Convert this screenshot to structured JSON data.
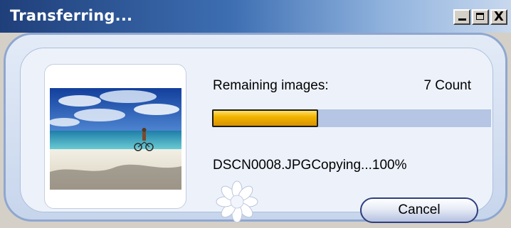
{
  "window": {
    "title": "Transferring...",
    "controls": {
      "minimize": "minimize",
      "maximize": "maximize",
      "close": "X"
    }
  },
  "transfer": {
    "remaining_label": "Remaining images:",
    "count_text": "7 Count",
    "progress_fraction": 0.38,
    "status_text": "DSCN0008.JPGCopying...100%"
  },
  "buttons": {
    "cancel_label": "Cancel"
  },
  "icons": {
    "thumbnail": "beach-photo",
    "busy": "spinner-icon"
  },
  "colors": {
    "title_bar_start": "#1f3f7a",
    "panel_background": "#c7d5ec",
    "progress_fill": "#f2b400",
    "progress_track": "#b5c5e3"
  }
}
